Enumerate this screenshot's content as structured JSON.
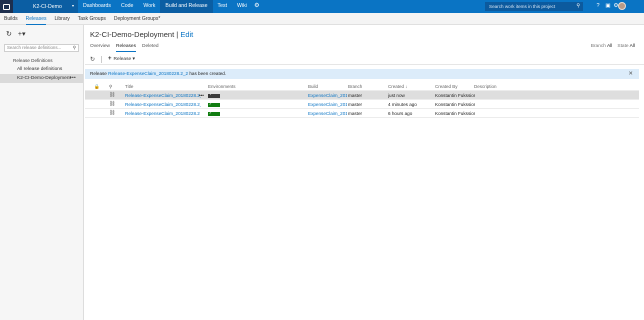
{
  "topbar": {
    "project": "K2-CI-Demo",
    "nav": [
      "Dashboards",
      "Code",
      "Work",
      "Build and Release",
      "Test",
      "Wiki"
    ],
    "active_nav": "Build and Release",
    "search_placeholder": "Search work items in this project",
    "icons": [
      "search-icon",
      "help-icon",
      "bag-icon",
      "settings-icon",
      "user-avatar"
    ]
  },
  "subnav": {
    "items": [
      "Builds",
      "Releases",
      "Library",
      "Task Groups",
      "Deployment Groups*"
    ],
    "active": "Releases"
  },
  "leftpane": {
    "refresh_icon": "↻",
    "add_icon": "+▾",
    "search_placeholder": "Search release definitions...",
    "heading": "Release Definitions",
    "items": [
      {
        "label": "All release definitions"
      },
      {
        "label": "K2-CI-Demo-Deployment",
        "more": "•••"
      }
    ]
  },
  "main": {
    "title": "K2-CI-Demo-Deployment",
    "title_sep": " | ",
    "edit_label": "Edit",
    "tabs": [
      "Overview",
      "Releases",
      "Deleted"
    ],
    "active_tab": "Releases",
    "view_label": "Branch",
    "view_all": "All",
    "state_label": "State",
    "state_all": "All",
    "release_button": "Release",
    "banner": {
      "prefix": "Release",
      "link": "Release-ExpenseClaim_20180228.2_2",
      "suffix": "has been created."
    },
    "columns": {
      "title": "Title",
      "environments": "Environments",
      "build": "Build",
      "branch": "Branch",
      "created": "Created ↓",
      "created_by": "Created By",
      "description": "Description"
    },
    "rows": [
      {
        "title": "Release-ExpenseClaim_20180228.2_2",
        "more": "•••",
        "env_state": "in-progress",
        "build": "ExpenseClaim_20180",
        "branch": "master",
        "created": "just now",
        "created_by": "Konstantin Fukssion",
        "description": ""
      },
      {
        "title": "Release-ExpenseClaim_20180228.2_1",
        "more": "",
        "env_state": "succeeded",
        "build": "ExpenseClaim_20180",
        "branch": "master",
        "created": "4 minutes ago",
        "created_by": "Konstantin Fukssion",
        "description": ""
      },
      {
        "title": "Release-ExpenseClaim_20180228.2",
        "more": "",
        "env_state": "succeeded",
        "build": "ExpenseClaim_20180",
        "branch": "master",
        "created": "6 hours ago",
        "created_by": "Konstantin Fukssion",
        "description": ""
      }
    ]
  },
  "colors": {
    "brand_blue": "#0a74c4",
    "success_green": "#107c10",
    "banner_bg": "#dcecfa"
  }
}
